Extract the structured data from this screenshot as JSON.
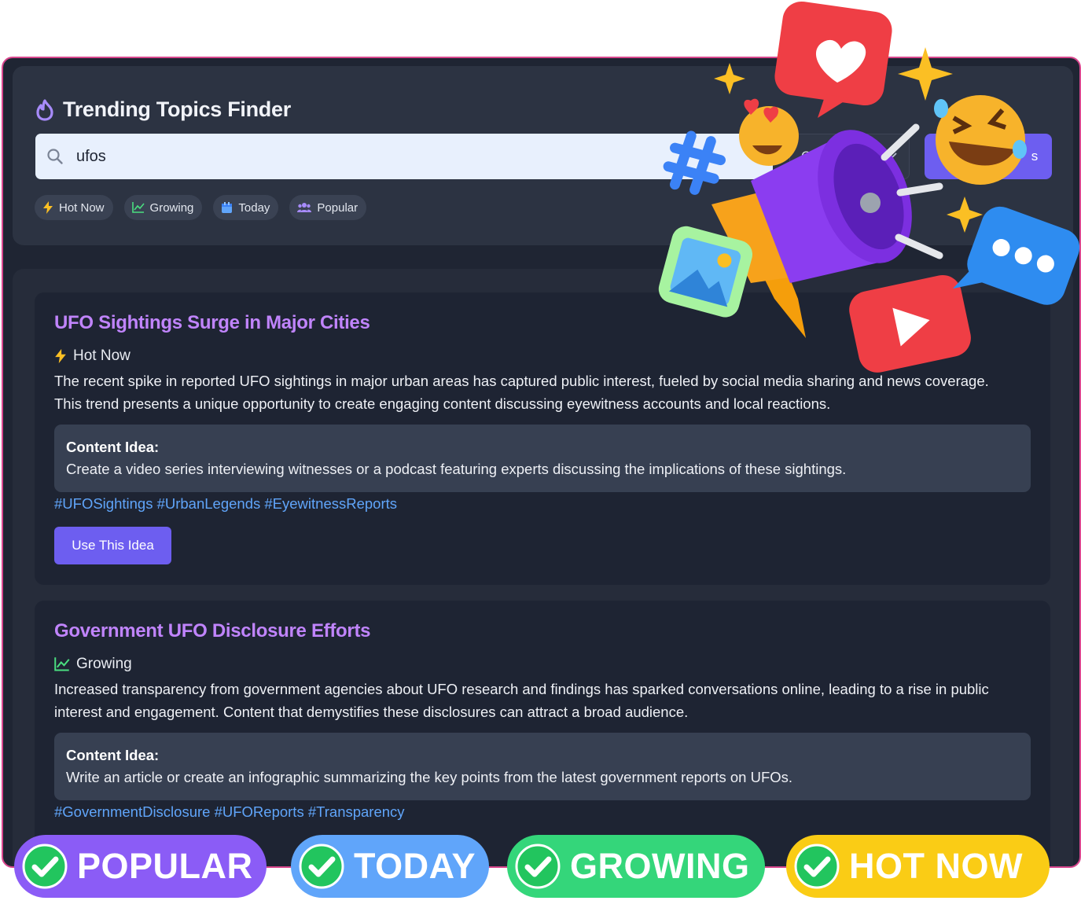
{
  "app": {
    "title": "Trending Topics Finder",
    "icon": "flame-icon"
  },
  "search": {
    "value": "ufos",
    "category_label": "C",
    "button_label": "s"
  },
  "filters": [
    {
      "label": "Hot Now",
      "icon": "lightning-icon"
    },
    {
      "label": "Growing",
      "icon": "trend-chart-icon"
    },
    {
      "label": "Today",
      "icon": "calendar-icon"
    },
    {
      "label": "Popular",
      "icon": "users-icon"
    }
  ],
  "results": [
    {
      "title": "UFO Sightings Surge in Major Cities",
      "trend": "Hot Now",
      "trend_icon": "lightning-icon",
      "description": "The recent spike in reported UFO sightings in major urban areas has captured public interest, fueled by social media sharing and news coverage. This trend presents a unique opportunity to create engaging content discussing eyewitness accounts and local reactions.",
      "idea_label": "Content Idea:",
      "idea": "Create a video series interviewing witnesses or a podcast featuring experts discussing the implications of these sightings.",
      "hashtags": "#UFOSightings #UrbanLegends #EyewitnessReports",
      "action_label": "Use This Idea"
    },
    {
      "title": "Government UFO Disclosure Efforts",
      "trend": "Growing",
      "trend_icon": "trend-chart-icon",
      "description": "Increased transparency from government agencies about UFO research and findings has sparked conversations online, leading to a rise in public interest and engagement. Content that demystifies these disclosures can attract a broad audience.",
      "idea_label": "Content Idea:",
      "idea": "Write an article or create an infographic summarizing the key points from the latest government reports on UFOs.",
      "hashtags": "#GovernmentDisclosure #UFOReports #Transparency"
    }
  ],
  "badges": [
    {
      "label": "POPULAR",
      "color": "#8b5cf6"
    },
    {
      "label": "TODAY",
      "color": "#60a5fa"
    },
    {
      "label": "GROWING",
      "color": "#34d67a"
    },
    {
      "label": "HOT NOW",
      "color": "#facc15"
    }
  ],
  "colors": {
    "accent": "#6d5ef0",
    "title_purple": "#c084fc",
    "hashtag_blue": "#60a5fa",
    "border_pink": "#d9478e"
  }
}
